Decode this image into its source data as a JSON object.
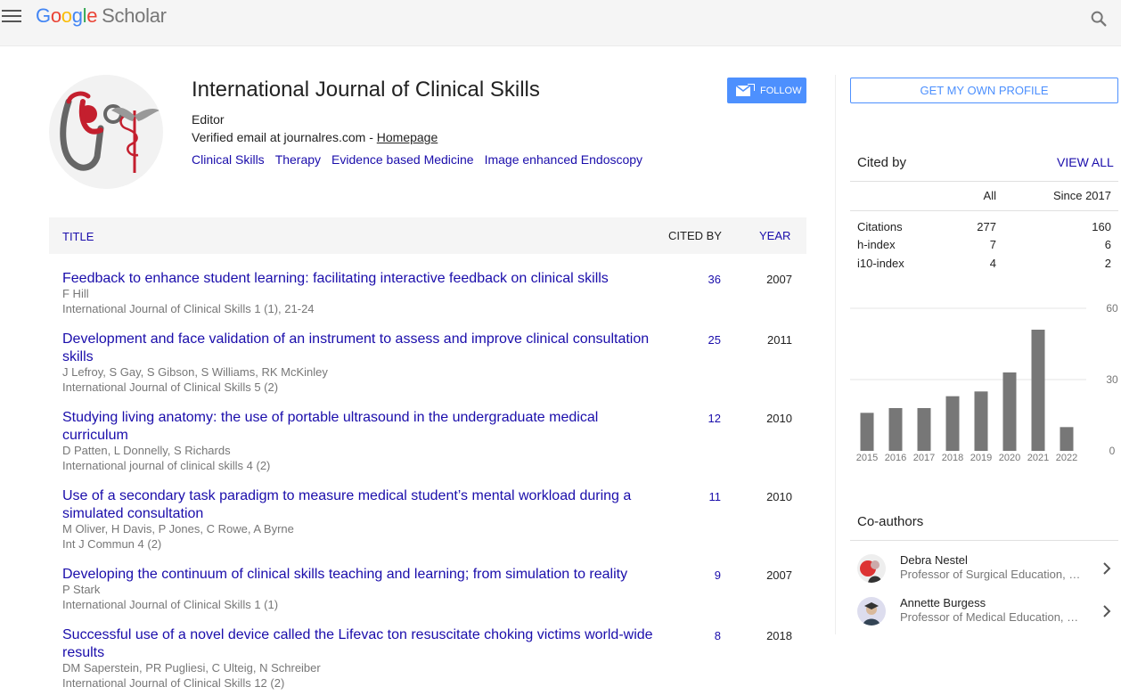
{
  "header": {
    "logo_google": "Google",
    "logo_scholar": "Scholar",
    "menu_icon": "hamburger-icon",
    "search_icon": "search-icon"
  },
  "profile": {
    "name": "International Journal of Clinical Skills",
    "affiliation": "Editor",
    "verified_text": "Verified email at journalres.com -",
    "homepage_label": "Homepage",
    "interests": [
      "Clinical Skills",
      "Therapy",
      "Evidence based Medicine",
      "Image enhanced Endoscopy"
    ],
    "follow_label": "FOLLOW",
    "follow_icon": "envelope-icon"
  },
  "table": {
    "headers": {
      "title": "TITLE",
      "cited_by": "CITED BY",
      "year": "YEAR"
    },
    "articles": [
      {
        "title": "Feedback to enhance student learning: facilitating interactive feedback on clinical skills",
        "authors": "F Hill",
        "venue": "International Journal of Clinical Skills 1 (1), 21-24",
        "cited_by": "36",
        "year": "2007"
      },
      {
        "title": "Development and face validation of an instrument to assess and improve clinical consultation skills",
        "authors": "J Lefroy, S Gay, S Gibson, S Williams, RK McKinley",
        "venue": "International Journal of Clinical Skills 5 (2)",
        "cited_by": "25",
        "year": "2011"
      },
      {
        "title": "Studying living anatomy: the use of portable ultrasound in the undergraduate medical curriculum",
        "authors": "D Patten, L Donnelly, S Richards",
        "venue": "International journal of clinical skills 4 (2)",
        "cited_by": "12",
        "year": "2010"
      },
      {
        "title": "Use of a secondary task paradigm to measure medical student’s mental workload during a simulated consultation",
        "authors": "M Oliver, H Davis, P Jones, C Rowe, A Byrne",
        "venue": "Int J Commun 4 (2)",
        "cited_by": "11",
        "year": "2010"
      },
      {
        "title": "Developing the continuum of clinical skills teaching and learning; from simulation to reality",
        "authors": "P Stark",
        "venue": "International Journal of Clinical Skills 1 (1)",
        "cited_by": "9",
        "year": "2007"
      },
      {
        "title": "Successful use of a novel device called the Lifevac ton resuscitate choking victims world-wide results",
        "authors": "DM Saperstein, PR Pugliesi, C Ulteig, N Schreiber",
        "venue": "International Journal of Clinical Skills 12 (2)",
        "cited_by": "8",
        "year": "2018"
      }
    ]
  },
  "sidebar": {
    "get_profile_label": "GET MY OWN PROFILE",
    "cited_by_title": "Cited by",
    "view_all_label": "VIEW ALL",
    "col_all": "All",
    "col_since": "Since 2017",
    "stats": [
      {
        "label": "Citations",
        "all": "277",
        "since": "160"
      },
      {
        "label": "h-index",
        "all": "7",
        "since": "6"
      },
      {
        "label": "i10-index",
        "all": "4",
        "since": "2"
      }
    ],
    "coauthors_title": "Co-authors",
    "coauthors": [
      {
        "name": "Debra Nestel",
        "affiliation": "Professor of Surgical Education, …"
      },
      {
        "name": "Annette Burgess",
        "affiliation": "Professor of Medical Education, …"
      }
    ],
    "chevron_icon": "chevron-right-icon"
  },
  "chart_data": {
    "type": "bar",
    "categories": [
      "2015",
      "2016",
      "2017",
      "2018",
      "2019",
      "2020",
      "2021",
      "2022"
    ],
    "values": [
      16,
      18,
      18,
      23,
      25,
      33,
      51,
      10
    ],
    "ylim": [
      0,
      60
    ],
    "yticks": [
      "0",
      "30",
      "60"
    ],
    "bar_color": "#777777",
    "grid": true
  }
}
